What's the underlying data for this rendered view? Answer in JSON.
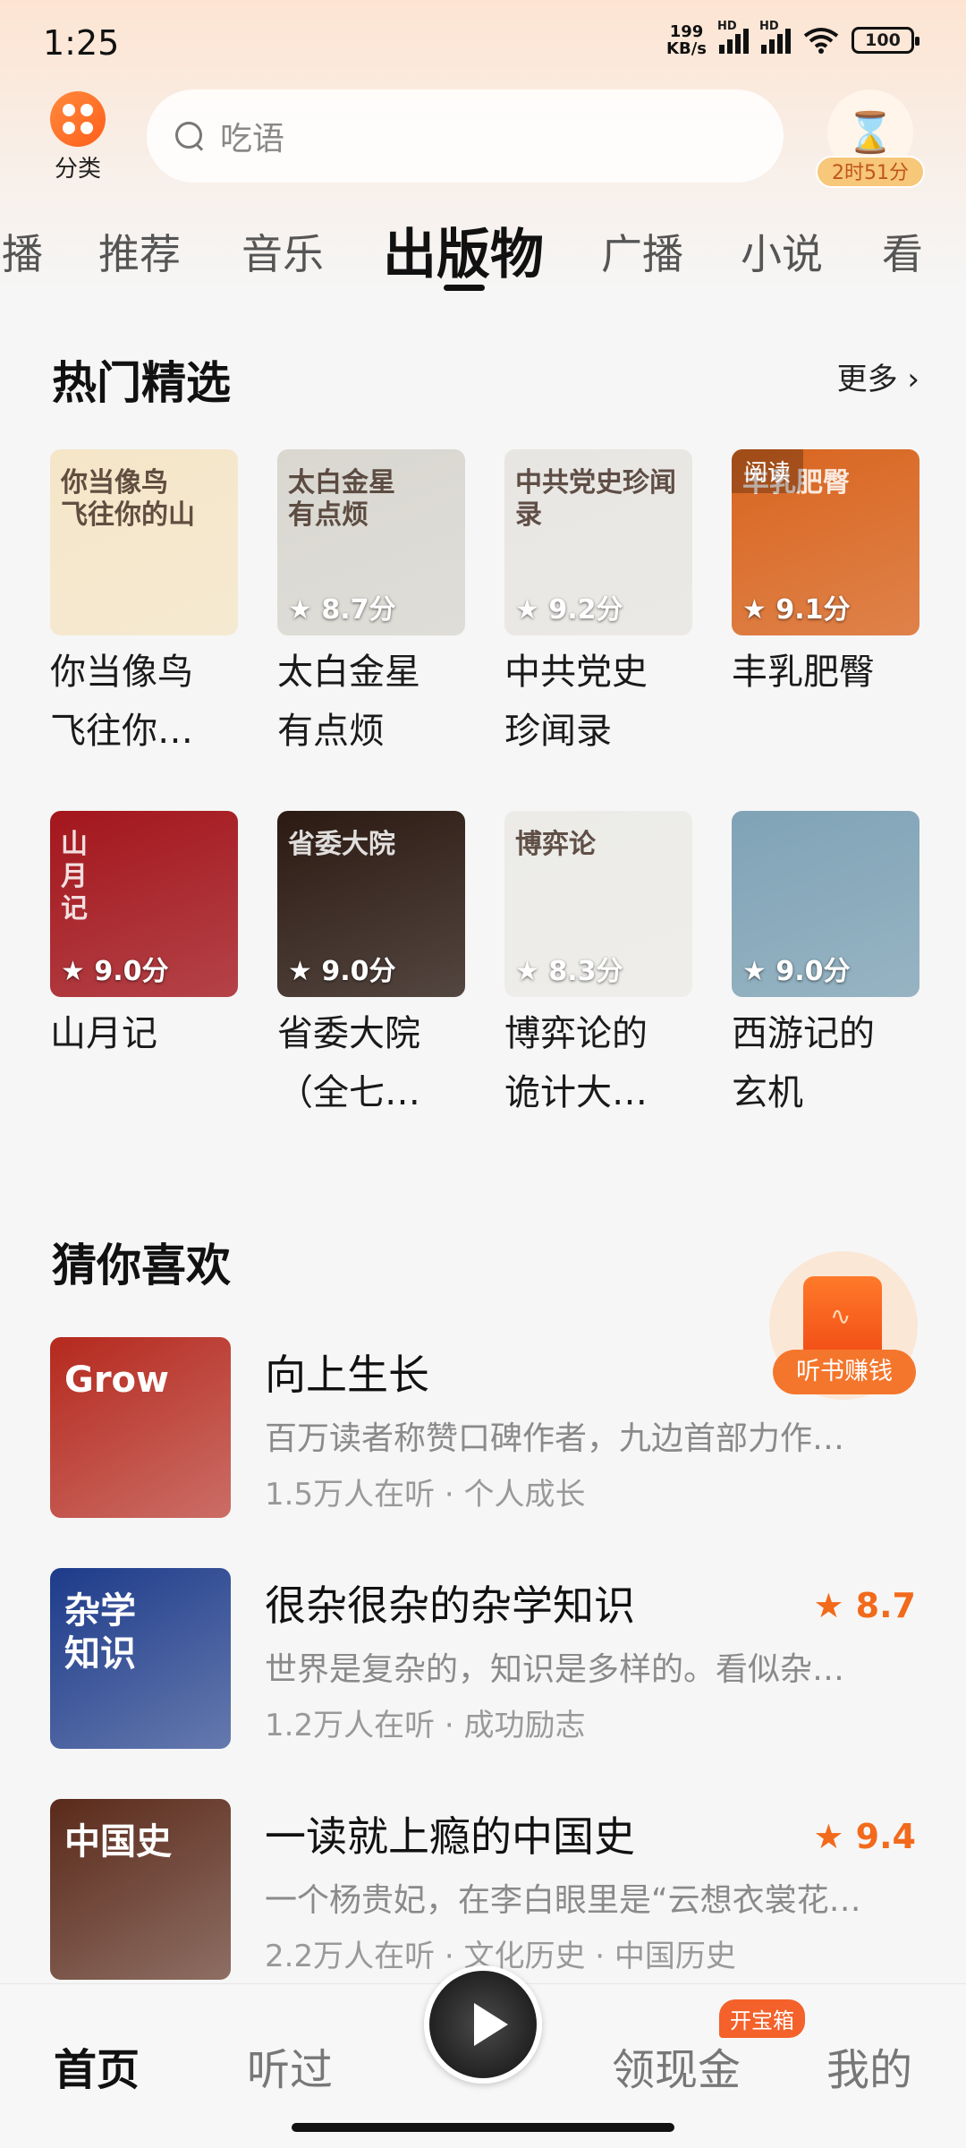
{
  "status": {
    "time": "1:25",
    "net_speed_top": "199",
    "net_speed_bottom": "KB/s",
    "hd1": "HD",
    "hd2": "HD",
    "battery": "100"
  },
  "header": {
    "category_label": "分类",
    "search_placeholder": "吃语",
    "timer_label": "2时51分"
  },
  "tabs": [
    "播",
    "推荐",
    "音乐",
    "出版物",
    "广播",
    "小说",
    "看"
  ],
  "hot": {
    "title": "热门精选",
    "more": "更多",
    "more_arrow": "›",
    "books": [
      {
        "title1": "你当像鸟",
        "title2": "飞往你…",
        "rating": "",
        "cover_text": "你当像鸟\n飞往你的山",
        "color": "#f5e6c8"
      },
      {
        "title1": "太白金星",
        "title2": "有点烦",
        "rating": "8.7分",
        "cover_text": "太白金星\n有点烦",
        "color": "#d9d7d0"
      },
      {
        "title1": "中共党史",
        "title2": "珍闻录",
        "rating": "9.2分",
        "cover_text": "中共党史珍闻录",
        "color": "#e8e6e2"
      },
      {
        "title1": "丰乳肥臀",
        "title2": "",
        "rating": "9.1分",
        "cover_text": "丰乳肥臀",
        "color": "#d9651f",
        "badge": "阅读"
      },
      {
        "title1": "山月记",
        "title2": "",
        "rating": "9.0分",
        "cover_text": "山\n月\n记",
        "color": "#a3161c"
      },
      {
        "title1": "省委大院",
        "title2": "（全七…",
        "rating": "9.0分",
        "cover_text": "省委大院",
        "color": "#2b1a12"
      },
      {
        "title1": "博弈论的",
        "title2": "诡计大…",
        "rating": "8.3分",
        "cover_text": "博弈论",
        "color": "#ecebe7"
      },
      {
        "title1": "西游记的",
        "title2": "玄机",
        "rating": "9.0分",
        "cover_text": "",
        "color": "#7fa3b6"
      }
    ]
  },
  "guess": {
    "title": "猜你喜欢",
    "items": [
      {
        "title": "向上生长",
        "desc": "百万读者称赞口碑作者，九边首部力作…",
        "meta": "1.5万人在听 · 个人成长",
        "score": "",
        "cover_text": "Grow",
        "color": "#b5291e"
      },
      {
        "title": "很杂很杂的杂学知识",
        "desc": "世界是复杂的，知识是多样的。看似杂…",
        "meta": "1.2万人在听 · 成功励志",
        "score": "8.7",
        "cover_text": "杂学\n知识",
        "color": "#1d3b8a"
      },
      {
        "title": "一读就上瘾的中国史",
        "desc": "一个杨贵妃，在李白眼里是“云想衣裳花…",
        "meta": "2.2万人在听 · 文化历史 · 中国历史",
        "score": "9.4",
        "cover_text": "中国史",
        "color": "#5a2a1a"
      }
    ]
  },
  "earn_label": "听书赚钱",
  "nav": {
    "home": "首页",
    "heard": "听过",
    "cash": "领现金",
    "mine": "我的",
    "box_badge": "开宝箱"
  }
}
